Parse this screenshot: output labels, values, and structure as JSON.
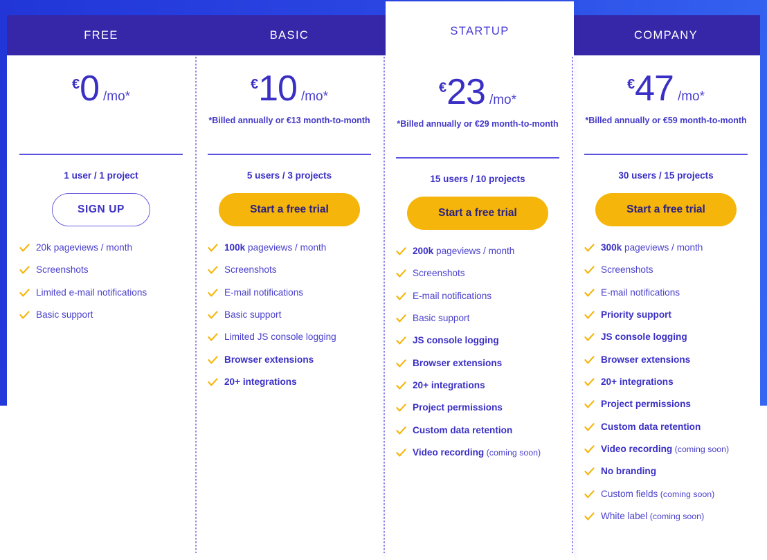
{
  "theme": {
    "banner_blue": "#2a45e2",
    "header_indigo": "#3527a8",
    "text_purple": "#3a2fc4",
    "accent_yellow": "#f5b50a",
    "rule_purple": "#5b52e0"
  },
  "plans": [
    {
      "name": "FREE",
      "featured": false,
      "currency": "€",
      "amount": "0",
      "per": "/mo*",
      "billed_note": "",
      "seats": "1 user / 1 project",
      "cta": "SIGN UP",
      "cta_style": "outline",
      "features": [
        {
          "prefix": "",
          "text": "20k pageviews / month",
          "bold": false,
          "soon": ""
        },
        {
          "prefix": "",
          "text": "Screenshots",
          "bold": false,
          "soon": ""
        },
        {
          "prefix": "",
          "text": "Limited e-mail notifications",
          "bold": false,
          "soon": ""
        },
        {
          "prefix": "",
          "text": "Basic support",
          "bold": false,
          "soon": ""
        }
      ]
    },
    {
      "name": "BASIC",
      "featured": false,
      "currency": "€",
      "amount": "10",
      "per": "/mo*",
      "billed_note": "*Billed annually or €13 month-to-month",
      "seats": "5 users / 3 projects",
      "cta": "Start a free trial",
      "cta_style": "primary",
      "features": [
        {
          "prefix": "100k",
          "text": " pageviews / month",
          "bold": false,
          "soon": ""
        },
        {
          "prefix": "",
          "text": "Screenshots",
          "bold": false,
          "soon": ""
        },
        {
          "prefix": "",
          "text": "E-mail notifications",
          "bold": false,
          "soon": ""
        },
        {
          "prefix": "",
          "text": "Basic support",
          "bold": false,
          "soon": ""
        },
        {
          "prefix": "",
          "text": "Limited JS console logging",
          "bold": false,
          "soon": ""
        },
        {
          "prefix": "",
          "text": "Browser extensions",
          "bold": true,
          "soon": ""
        },
        {
          "prefix": "",
          "text": "20+ integrations",
          "bold": true,
          "soon": ""
        }
      ]
    },
    {
      "name": "STARTUP",
      "featured": true,
      "currency": "€",
      "amount": "23",
      "per": "/mo*",
      "billed_note": "*Billed annually or €29 month-to-month",
      "seats": "15 users / 10 projects",
      "cta": "Start a free trial",
      "cta_style": "primary",
      "features": [
        {
          "prefix": "200k",
          "text": " pageviews / month",
          "bold": false,
          "soon": ""
        },
        {
          "prefix": "",
          "text": "Screenshots",
          "bold": false,
          "soon": ""
        },
        {
          "prefix": "",
          "text": "E-mail notifications",
          "bold": false,
          "soon": ""
        },
        {
          "prefix": "",
          "text": "Basic support",
          "bold": false,
          "soon": ""
        },
        {
          "prefix": "",
          "text": "JS console logging",
          "bold": true,
          "soon": ""
        },
        {
          "prefix": "",
          "text": "Browser extensions",
          "bold": true,
          "soon": ""
        },
        {
          "prefix": "",
          "text": "20+ integrations",
          "bold": true,
          "soon": ""
        },
        {
          "prefix": "",
          "text": "Project permissions",
          "bold": true,
          "soon": ""
        },
        {
          "prefix": "",
          "text": "Custom data retention",
          "bold": true,
          "soon": ""
        },
        {
          "prefix": "",
          "text": "Video recording",
          "bold": true,
          "soon": " (coming soon)"
        }
      ]
    },
    {
      "name": "COMPANY",
      "featured": false,
      "currency": "€",
      "amount": "47",
      "per": "/mo*",
      "billed_note": "*Billed annually or €59 month-to-month",
      "seats": "30 users / 15 projects",
      "cta": "Start a free trial",
      "cta_style": "primary",
      "features": [
        {
          "prefix": "300k",
          "text": " pageviews / month",
          "bold": false,
          "soon": ""
        },
        {
          "prefix": "",
          "text": "Screenshots",
          "bold": false,
          "soon": ""
        },
        {
          "prefix": "",
          "text": "E-mail notifications",
          "bold": false,
          "soon": ""
        },
        {
          "prefix": "",
          "text": "Priority support",
          "bold": true,
          "soon": ""
        },
        {
          "prefix": "",
          "text": "JS console logging",
          "bold": true,
          "soon": ""
        },
        {
          "prefix": "",
          "text": "Browser extensions",
          "bold": true,
          "soon": ""
        },
        {
          "prefix": "",
          "text": "20+ integrations",
          "bold": true,
          "soon": ""
        },
        {
          "prefix": "",
          "text": "Project permissions",
          "bold": true,
          "soon": ""
        },
        {
          "prefix": "",
          "text": "Custom data retention",
          "bold": true,
          "soon": ""
        },
        {
          "prefix": "",
          "text": "Video recording",
          "bold": true,
          "soon": " (coming soon)"
        },
        {
          "prefix": "",
          "text": "No branding",
          "bold": true,
          "soon": ""
        },
        {
          "prefix": "",
          "text": "Custom fields",
          "bold": false,
          "soon": " (coming soon)"
        },
        {
          "prefix": "",
          "text": "White label",
          "bold": false,
          "soon": " (coming soon)"
        }
      ]
    }
  ],
  "icons": {
    "check": "check-icon"
  }
}
